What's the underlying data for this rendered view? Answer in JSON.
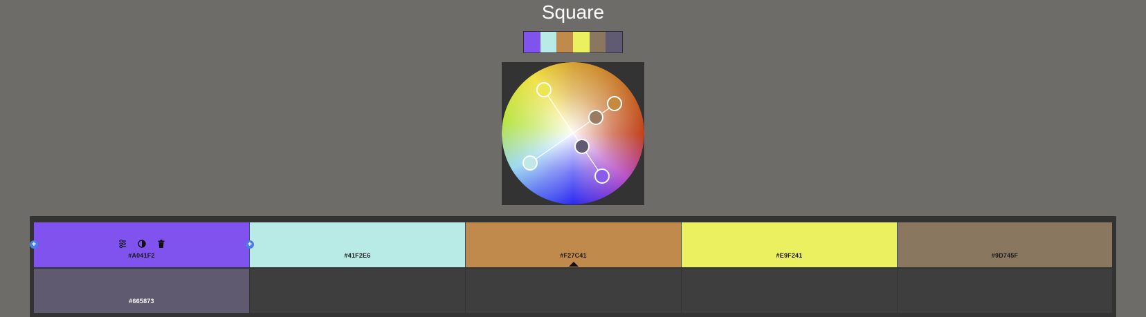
{
  "title": "Square",
  "strip_colors": [
    "#8052EE",
    "#B8EAE6",
    "#C08A4C",
    "#EAF060",
    "#8A775F",
    "#605A72"
  ],
  "palette": {
    "row1": [
      {
        "hex": "#A041F2",
        "color": "#8052EE"
      },
      {
        "hex": "#41F2E6",
        "color": "#B8EAE6"
      },
      {
        "hex": "#F27C41",
        "color": "#C08A4C"
      },
      {
        "hex": "#E9F241",
        "color": "#EAF060"
      },
      {
        "hex": "#9D745F",
        "color": "#8A775F"
      }
    ],
    "row2": [
      {
        "hex": "#665873",
        "color": "#5F5A70"
      }
    ]
  },
  "icons": {
    "adjust": "sliders-icon",
    "contrast": "contrast-icon",
    "delete": "trash-icon",
    "add": "plus-icon",
    "selected": "caret-up-icon"
  }
}
